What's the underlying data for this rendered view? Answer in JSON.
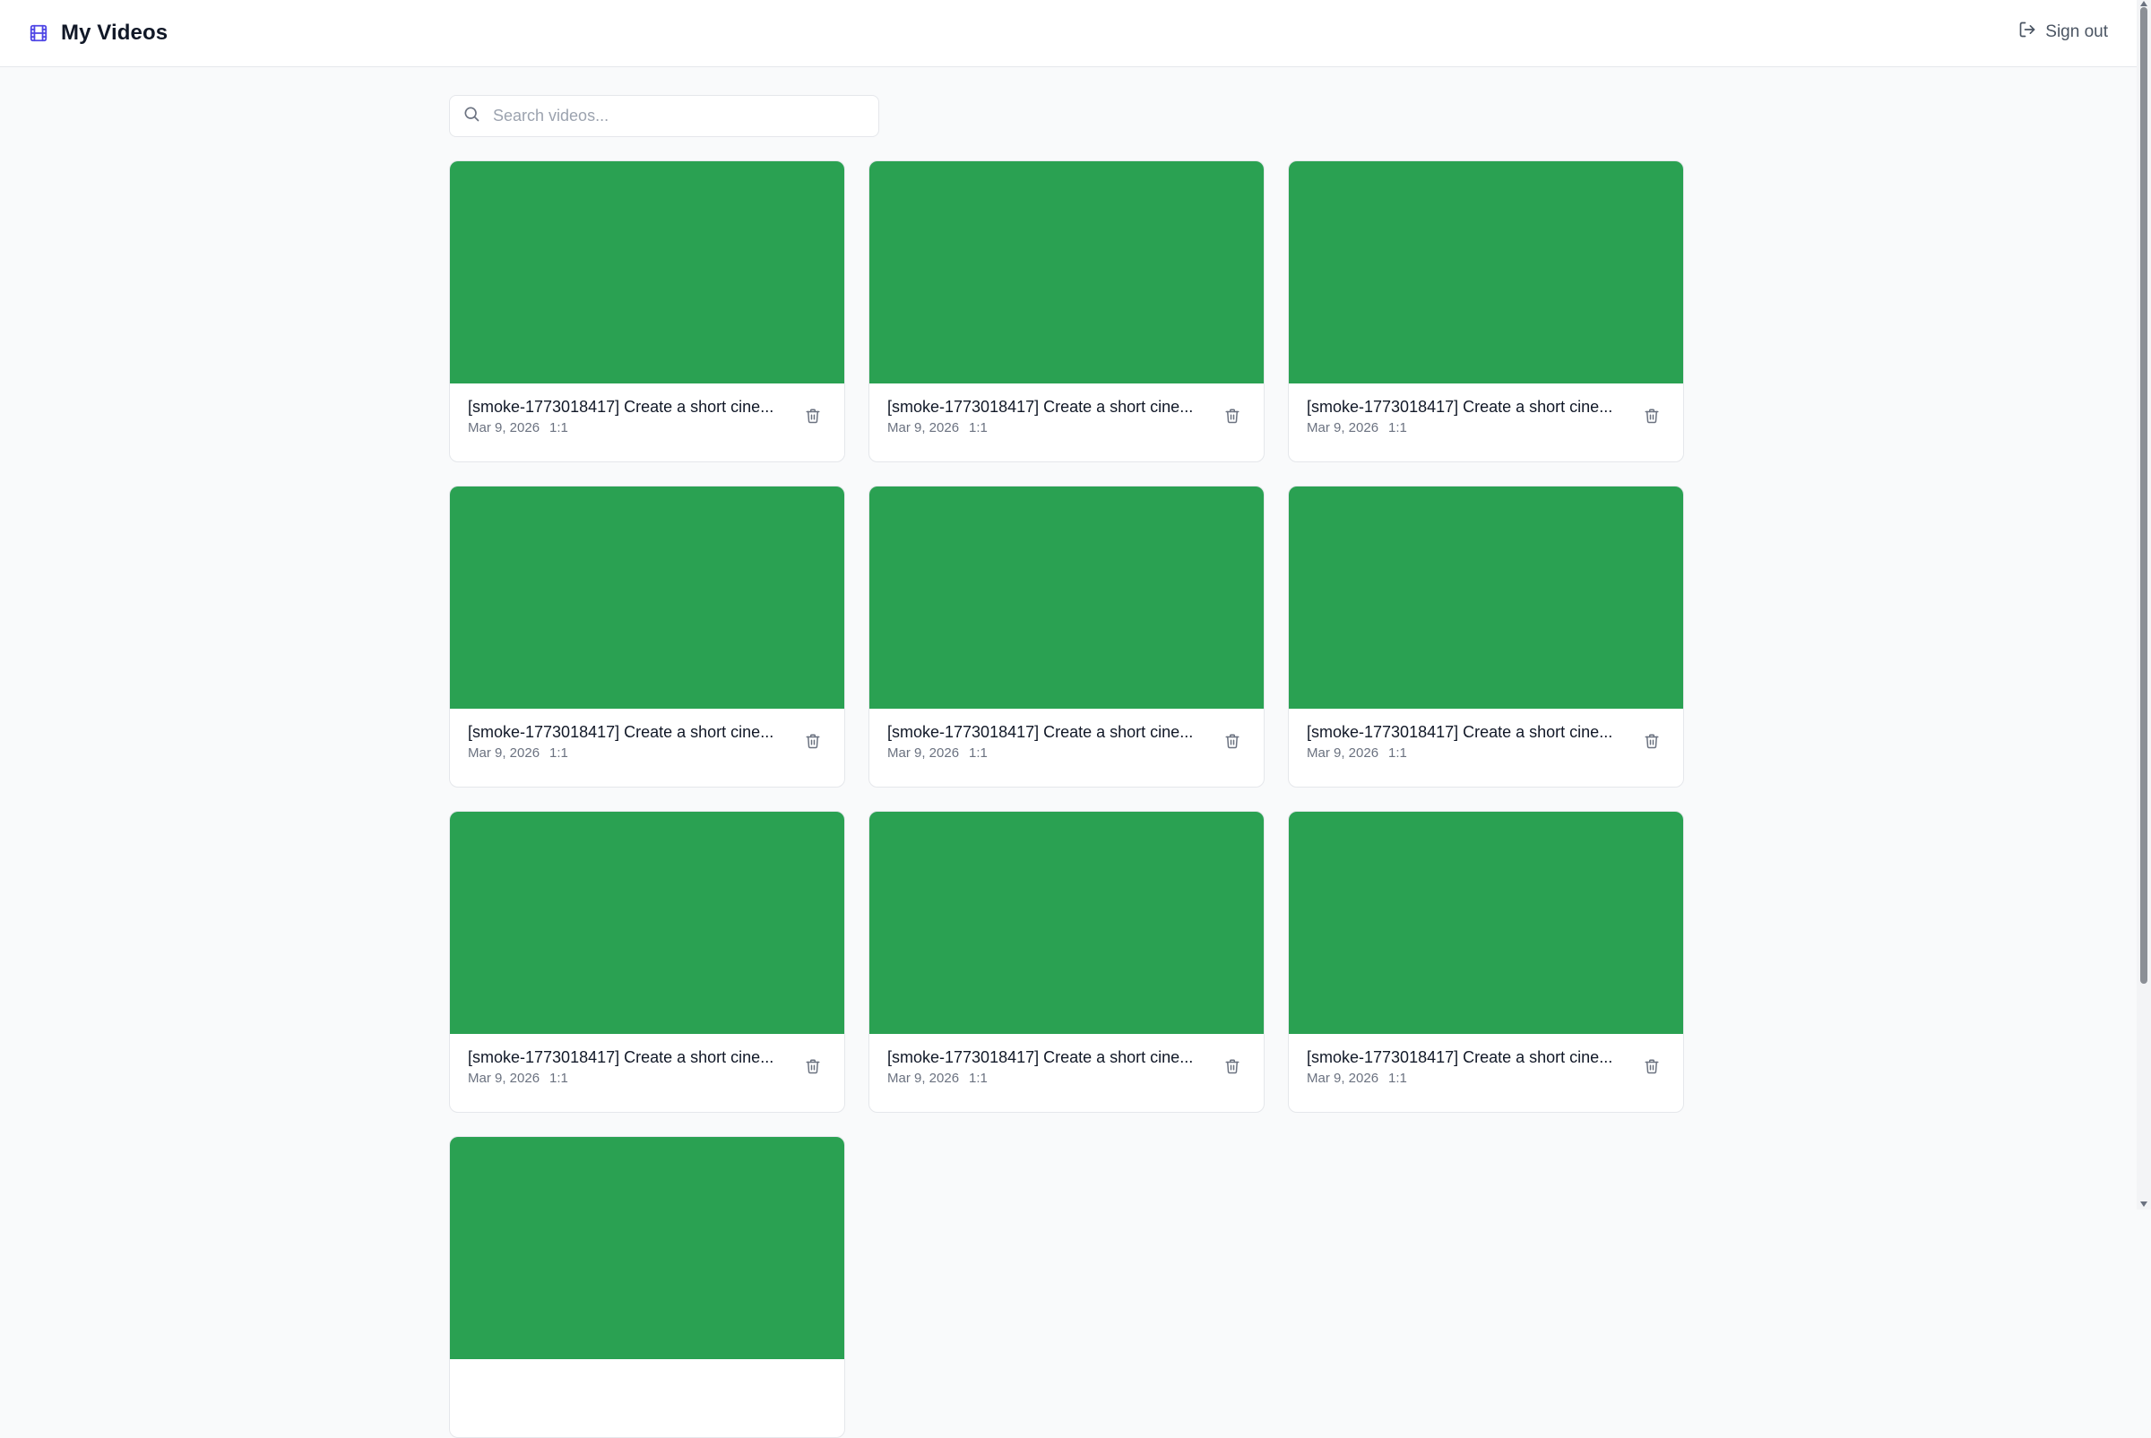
{
  "header": {
    "title": "My Videos",
    "brand_icon": "film-icon",
    "signout_label": "Sign out",
    "signout_icon": "log-out-icon"
  },
  "search": {
    "placeholder": "Search videos...",
    "value": ""
  },
  "videos": [
    {
      "title": "[smoke-1773018417] Create a short cine...",
      "date": "Mar 9, 2026",
      "ratio": "1:1"
    },
    {
      "title": "[smoke-1773018417] Create a short cine...",
      "date": "Mar 9, 2026",
      "ratio": "1:1"
    },
    {
      "title": "[smoke-1773018417] Create a short cine...",
      "date": "Mar 9, 2026",
      "ratio": "1:1"
    },
    {
      "title": "[smoke-1773018417] Create a short cine...",
      "date": "Mar 9, 2026",
      "ratio": "1:1"
    },
    {
      "title": "[smoke-1773018417] Create a short cine...",
      "date": "Mar 9, 2026",
      "ratio": "1:1"
    },
    {
      "title": "[smoke-1773018417] Create a short cine...",
      "date": "Mar 9, 2026",
      "ratio": "1:1"
    },
    {
      "title": "[smoke-1773018417] Create a short cine...",
      "date": "Mar 9, 2026",
      "ratio": "1:1"
    },
    {
      "title": "[smoke-1773018417] Create a short cine...",
      "date": "Mar 9, 2026",
      "ratio": "1:1"
    },
    {
      "title": "[smoke-1773018417] Create a short cine...",
      "date": "Mar 9, 2026",
      "ratio": "1:1"
    },
    {
      "title": "",
      "date": "",
      "ratio": ""
    }
  ],
  "colors": {
    "thumbnail": "#2aa152",
    "accent": "#4f46e5",
    "background": "#f9fafb"
  }
}
